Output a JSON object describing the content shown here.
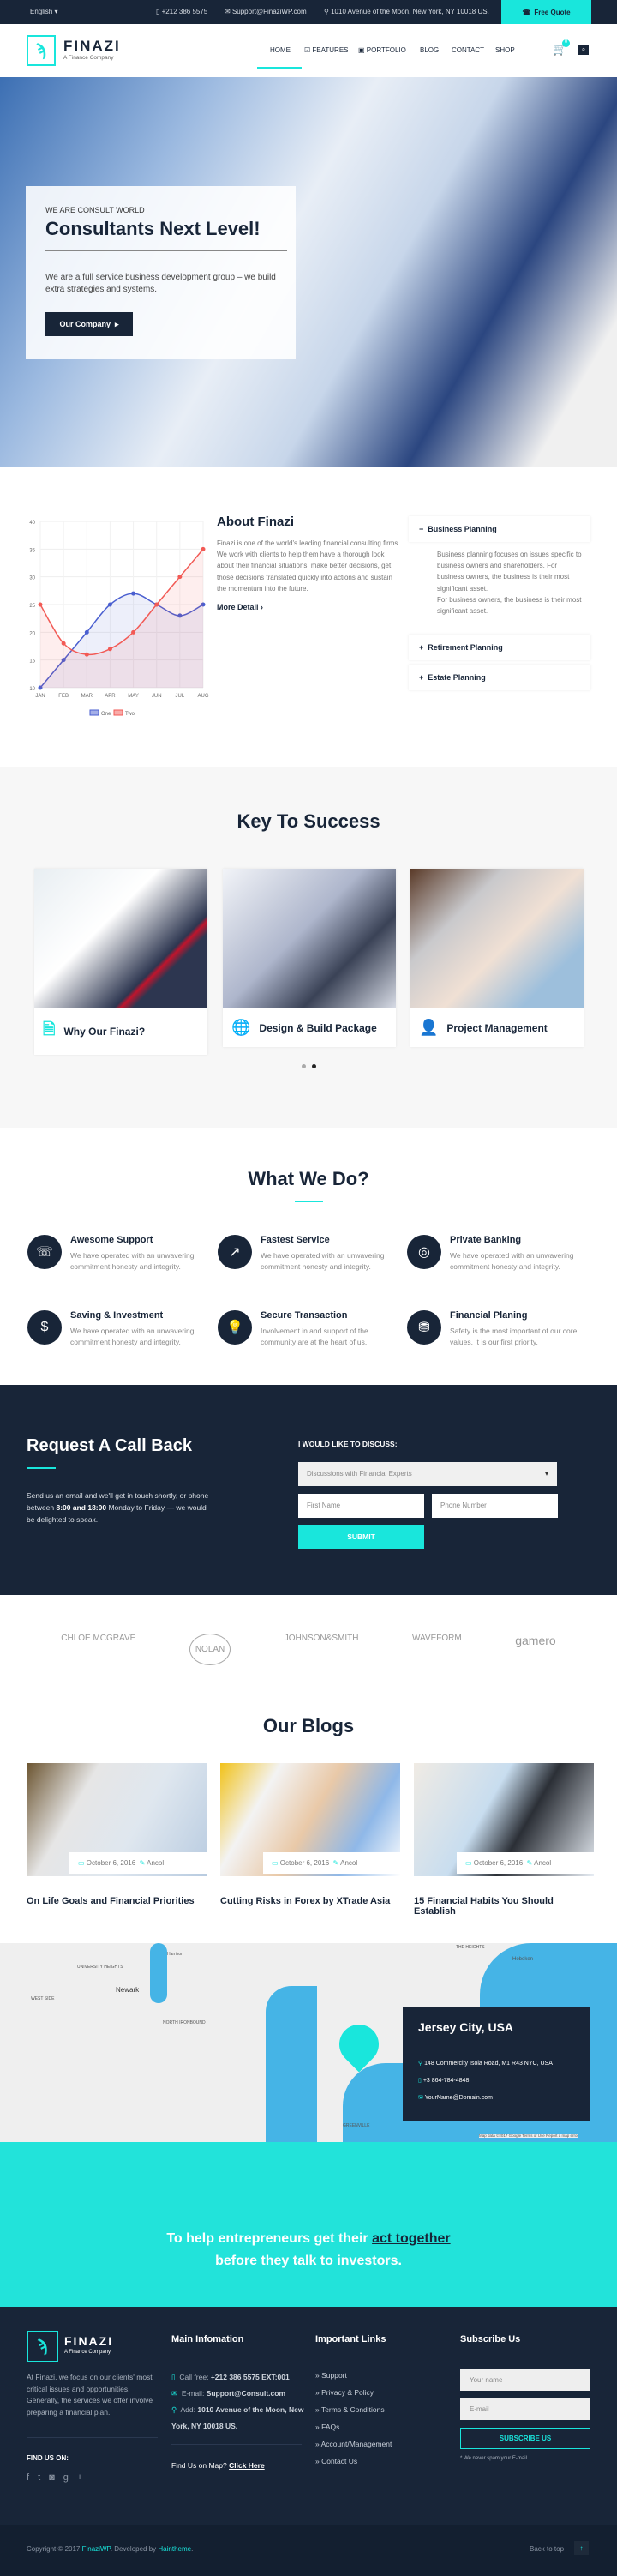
{
  "topbar": {
    "language": "English",
    "phone": "+212 386 5575",
    "email": "Support@FinaziWP.com",
    "address": "1010 Avenue of the Moon, New York, NY 10018 US.",
    "quote": "Free Quote"
  },
  "brand": {
    "name": "FINAZI",
    "tagline": "A Finance Company"
  },
  "nav": {
    "items": [
      "HOME",
      "FEATURES",
      "PORTFOLIO",
      "BLOG",
      "CONTACT",
      "SHOP"
    ],
    "cart_count": "0"
  },
  "hero": {
    "kicker": "WE ARE CONSULT WORLD",
    "title": "Consultants Next Level!",
    "text": "We are a full service business development group – we build extra strategies and systems.",
    "button": "Our Company"
  },
  "chart_data": {
    "type": "line",
    "categories": [
      "JAN",
      "FEB",
      "MAR",
      "APR",
      "MAY",
      "JUN",
      "JUL",
      "AUG"
    ],
    "ylim": [
      10,
      40
    ],
    "yticks": [
      10,
      15,
      20,
      25,
      30,
      35,
      40
    ],
    "grid": true,
    "legend": "bottom",
    "series": [
      {
        "name": "One",
        "color": "#4a5fd0",
        "values": [
          10,
          15,
          20,
          25,
          27,
          25,
          23,
          25
        ]
      },
      {
        "name": "Two",
        "color": "#f25a55",
        "values": [
          25,
          18,
          16,
          17,
          20,
          25,
          30,
          35
        ]
      }
    ]
  },
  "about": {
    "title": "About Finazi",
    "text": "Finazi is one of the world's leading financial consulting firms. We work with clients to help them have a thorough look about their financial situations, make better decisions, get those decisions translated quickly into actions and sustain the momentum into the future.",
    "link": "More Detail"
  },
  "accordion": [
    {
      "title": "Business Planning",
      "open": true,
      "body": "Business planning focuses on issues specific to business owners and shareholders. For business owners, the business is their most significant asset.",
      "body2": "For business owners, the business is their most significant asset."
    },
    {
      "title": "Retirement Planning",
      "open": false
    },
    {
      "title": "Estate Planning",
      "open": false
    }
  ],
  "keys": {
    "title": "Key To Success",
    "cards": [
      {
        "label": "Why Our Finazi?",
        "icon": "document-icon"
      },
      {
        "label": "Design & Build Package",
        "icon": "globe-icon"
      },
      {
        "label": "Project Management",
        "icon": "manager-icon"
      }
    ]
  },
  "services": {
    "title": "What We Do?",
    "items": [
      {
        "title": "Awesome Support",
        "text": "We have operated with an unwavering commitment honesty and integrity.",
        "icon": "support-icon"
      },
      {
        "title": "Fastest Service",
        "text": "We have operated with an unwavering commitment honesty and integrity.",
        "icon": "chart-up-icon"
      },
      {
        "title": "Private Banking",
        "text": "We have operated with an unwavering commitment honesty and integrity.",
        "icon": "target-icon"
      },
      {
        "title": "Saving & Investment",
        "text": "We have operated with an unwavering commitment honesty and integrity.",
        "icon": "piggy-bank-icon"
      },
      {
        "title": "Secure Transaction",
        "text": "Involvement in and support of the community are at the heart of us.",
        "icon": "lightbulb-icon"
      },
      {
        "title": "Financial Planing",
        "text": "Safety is the most important of our core values. It is our first priority.",
        "icon": "money-icon"
      }
    ]
  },
  "callback": {
    "title": "Request A Call Back",
    "text_a": "Send us an email and we'll get in touch shortly, or phone between ",
    "hours": "8:00 and 18:00",
    "text_b": " Monday to Friday — we would be delighted to speak.",
    "form_label": "I WOULD LIKE TO DISCUSS:",
    "select": "Discussions with Financial Experts",
    "first_name": "First Name",
    "phone": "Phone Number",
    "submit": "SUBMIT"
  },
  "partners": [
    "CHLOE MCGRAVE",
    "NOLAN",
    "JOHNSON&SMITH",
    "WAVEFORM",
    "gamero"
  ],
  "blogs": {
    "title": "Our Blogs",
    "posts": [
      {
        "date": "October 6, 2016",
        "author": "Ancol",
        "title": "On Life Goals and Financial Priorities"
      },
      {
        "date": "October 6, 2016",
        "author": "Ancol",
        "title": "Cutting Risks in Forex by XTrade Asia"
      },
      {
        "date": "October 6, 2016",
        "author": "Ancol",
        "title": "15 Financial Habits You Should Establish"
      }
    ]
  },
  "map": {
    "city": "Jersey City, USA",
    "address": "148 Commercity Isola Road, M1 R43 NYC, USA",
    "phone": "+3 864-784-4848",
    "email": "YourName@Domain.com",
    "labels": [
      "Newark",
      "UNIVERSITY HEIGHTS",
      "WEST SIDE",
      "NORTH IRONBOUND",
      "Harrison",
      "THE HEIGHTS",
      "Hoboken",
      "GREENVILLE"
    ],
    "attribution": "Map data ©2017 Google   Terms of Use   Report a map error"
  },
  "cta": {
    "text_a": "To help entrepreneurs get their ",
    "link": "act together",
    "text_b": "before they talk to investors."
  },
  "footer": {
    "about": "At Finazi, we focus on our clients' most critical issues and opportunities. Generally, the services we offer involve preparing a financial plan.",
    "find_us": "FIND US ON:",
    "main_title": "Main Infomation",
    "call_label": "Call free:",
    "call": "+212 386 5575 EXT:001",
    "email_label": "E-mail:",
    "email": "Support@Consult.com",
    "add_label": "Add:",
    "address": "1010 Avenue of the Moon, New York, NY 10018 US.",
    "map_q": "Find Us on Map?",
    "map_link": "Click Here",
    "links_title": "Important Links",
    "links": [
      "Support",
      "Privacy & Policy",
      "Terms & Conditions",
      "FAQs",
      "Account/Management",
      "Contact Us"
    ],
    "sub_title": "Subscribe Us",
    "name_ph": "Your name",
    "email_ph": "E-mail",
    "sub_btn": "SUBSCRIBE US",
    "note": "* We never spam your E-mail",
    "copy_a": "Copyright © 2017 ",
    "copy_brand": "FinaziWP",
    "copy_b": ". Developed by ",
    "copy_dev": "Haintheme",
    "back_top": "Back to top"
  }
}
